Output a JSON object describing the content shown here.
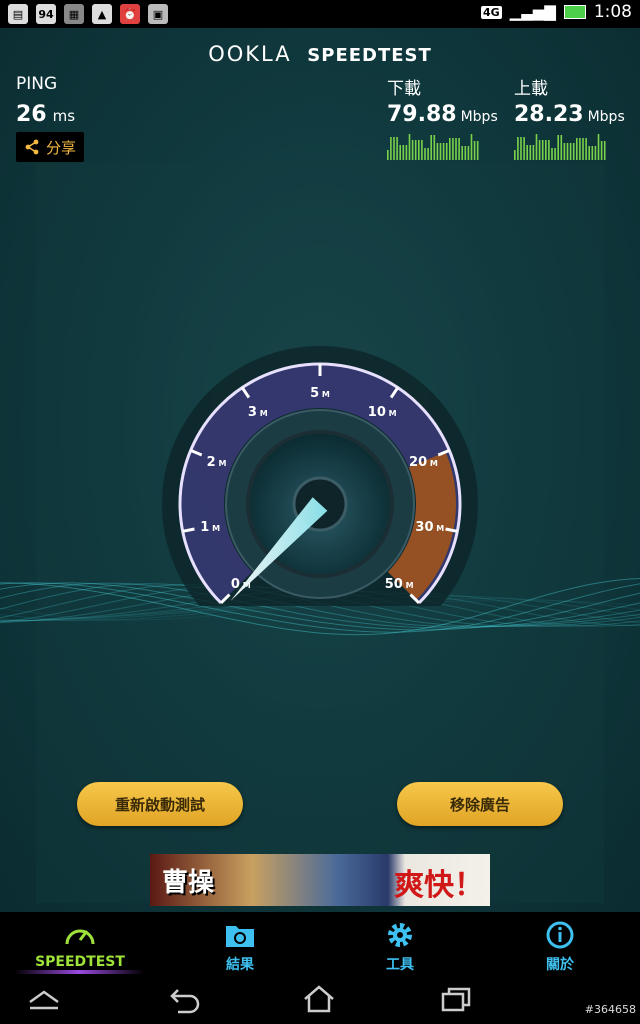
{
  "status_bar": {
    "icons_left": [
      "sim-icon",
      "battery-level-icon",
      "gallery-icon",
      "image-icon",
      "alarm-icon",
      "photo-icon"
    ],
    "battery_level_text": "94",
    "network": "4G",
    "time": "1:08"
  },
  "app": {
    "logo_text": "OOKLA",
    "logo_sub": "SPEEDTEST",
    "ping": {
      "label": "PING",
      "value": "26",
      "unit": "ms"
    },
    "share_label": "分享",
    "download": {
      "label": "下載",
      "value": "79.88",
      "unit": "Mbps"
    },
    "upload": {
      "label": "上載",
      "value": "28.23",
      "unit": "Mbps"
    },
    "gauge": {
      "labels": [
        "0",
        "1",
        "2",
        "3",
        "5",
        "10",
        "20",
        "30",
        "50"
      ],
      "unit_suffix": "M",
      "needle_value_mbps": 0
    },
    "restart_button": "重新啟動測試",
    "remove_ads_button": "移除廣告",
    "ad": {
      "text_left": "曹操",
      "text_right": "爽快！"
    }
  },
  "nav": {
    "items": [
      {
        "label": "SPEEDTEST",
        "icon": "speedometer-icon",
        "active": true
      },
      {
        "label": "結果",
        "icon": "folder-icon",
        "active": false
      },
      {
        "label": "工具",
        "icon": "gear-icon",
        "active": false
      },
      {
        "label": "關於",
        "icon": "info-icon",
        "active": false
      }
    ]
  },
  "watermark": "#364658",
  "colors": {
    "accent_gold": "#f4b940",
    "active_green": "#9ee23a",
    "nav_blue": "#3ec0f0",
    "gauge_purple": "#8a6ad8",
    "gauge_orange": "#e0872a"
  }
}
